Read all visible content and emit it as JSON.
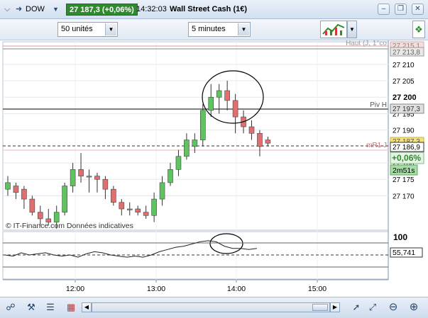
{
  "header": {
    "symbol": "DOW",
    "price_change": "27 187,3 (+0,06%)",
    "time": "14:32:03",
    "instrument": "Wall Street Cash (1€)"
  },
  "toolbar": {
    "units_select": "50 unités",
    "interval_select": "5 minutes"
  },
  "chart": {
    "price_ticks": [
      "27 210",
      "27 205",
      "27 200",
      "27 195",
      "27 190",
      "27 180",
      "27 175",
      "27 170"
    ],
    "level_haut_label": "Haut (J, 1°co",
    "level_haut_value": "27 215,1",
    "level_haut_value2": "27 213,8",
    "level_piv_label": "Piv H",
    "level_piv_value": "27 197,3",
    "current_label": "mR1 J",
    "current_value_top": "27 187,3",
    "current_value": "27 186,9",
    "change_pct": "+0,06%",
    "countdown": "2m51s",
    "watermark": "© IT-Finance.com  Données indicatives",
    "osc_top": "100",
    "osc_value": "55,741",
    "time_ticks": [
      "12:00",
      "13:00",
      "14:00",
      "15:00"
    ],
    "colors": {
      "up": "#5fc35f",
      "down": "#e07070",
      "level": "#555555",
      "current": "#cc3333"
    }
  },
  "chart_data": {
    "type": "candlestick",
    "x_labels": [
      "12:00",
      "13:00",
      "14:00",
      "15:00"
    ],
    "ylim": [
      27166,
      27216
    ],
    "candles": [
      {
        "o": 27172,
        "h": 27176,
        "l": 27170,
        "c": 27174
      },
      {
        "o": 27173,
        "h": 27174,
        "l": 27169,
        "c": 27171
      },
      {
        "o": 27172,
        "h": 27173,
        "l": 27166,
        "c": 27169
      },
      {
        "o": 27169,
        "h": 27170,
        "l": 27164,
        "c": 27165
      },
      {
        "o": 27165,
        "h": 27167,
        "l": 27161,
        "c": 27163
      },
      {
        "o": 27163,
        "h": 27166,
        "l": 27161,
        "c": 27162
      },
      {
        "o": 27162,
        "h": 27167,
        "l": 27160,
        "c": 27165
      },
      {
        "o": 27165,
        "h": 27174,
        "l": 27164,
        "c": 27173
      },
      {
        "o": 27173,
        "h": 27180,
        "l": 27171,
        "c": 27178
      },
      {
        "o": 27178,
        "h": 27183,
        "l": 27174,
        "c": 27176
      },
      {
        "o": 27176,
        "h": 27178,
        "l": 27171,
        "c": 27176
      },
      {
        "o": 27176,
        "h": 27177,
        "l": 27171,
        "c": 27175
      },
      {
        "o": 27175,
        "h": 27176,
        "l": 27169,
        "c": 27172
      },
      {
        "o": 27172,
        "h": 27173,
        "l": 27167,
        "c": 27168
      },
      {
        "o": 27168,
        "h": 27169,
        "l": 27164,
        "c": 27166
      },
      {
        "o": 27166,
        "h": 27168,
        "l": 27164,
        "c": 27166
      },
      {
        "o": 27166,
        "h": 27167,
        "l": 27164,
        "c": 27165
      },
      {
        "o": 27165,
        "h": 27167,
        "l": 27163,
        "c": 27164
      },
      {
        "o": 27164,
        "h": 27171,
        "l": 27162,
        "c": 27169
      },
      {
        "o": 27169,
        "h": 27176,
        "l": 27167,
        "c": 27174
      },
      {
        "o": 27174,
        "h": 27180,
        "l": 27173,
        "c": 27178
      },
      {
        "o": 27178,
        "h": 27184,
        "l": 27176,
        "c": 27182
      },
      {
        "o": 27182,
        "h": 27189,
        "l": 27181,
        "c": 27187
      },
      {
        "o": 27185,
        "h": 27189,
        "l": 27183,
        "c": 27187
      },
      {
        "o": 27187,
        "h": 27198,
        "l": 27185,
        "c": 27196
      },
      {
        "o": 27196,
        "h": 27204,
        "l": 27194,
        "c": 27200
      },
      {
        "o": 27200,
        "h": 27204,
        "l": 27195,
        "c": 27202
      },
      {
        "o": 27202,
        "h": 27205,
        "l": 27196,
        "c": 27199
      },
      {
        "o": 27199,
        "h": 27201,
        "l": 27189,
        "c": 27194
      },
      {
        "o": 27194,
        "h": 27196,
        "l": 27189,
        "c": 27191
      },
      {
        "o": 27191,
        "h": 27193,
        "l": 27187,
        "c": 27189
      },
      {
        "o": 27189,
        "h": 27190,
        "l": 27182,
        "c": 27185
      },
      {
        "o": 27187,
        "h": 27188,
        "l": 27185,
        "c": 27186
      }
    ],
    "oscillator": [
      50,
      49,
      52,
      50,
      51,
      52,
      50,
      49,
      50,
      48,
      51,
      53,
      52,
      50,
      49,
      48,
      49,
      48,
      50,
      53,
      55,
      57,
      58,
      60,
      62,
      63,
      62,
      58,
      56,
      56,
      55,
      56
    ]
  }
}
